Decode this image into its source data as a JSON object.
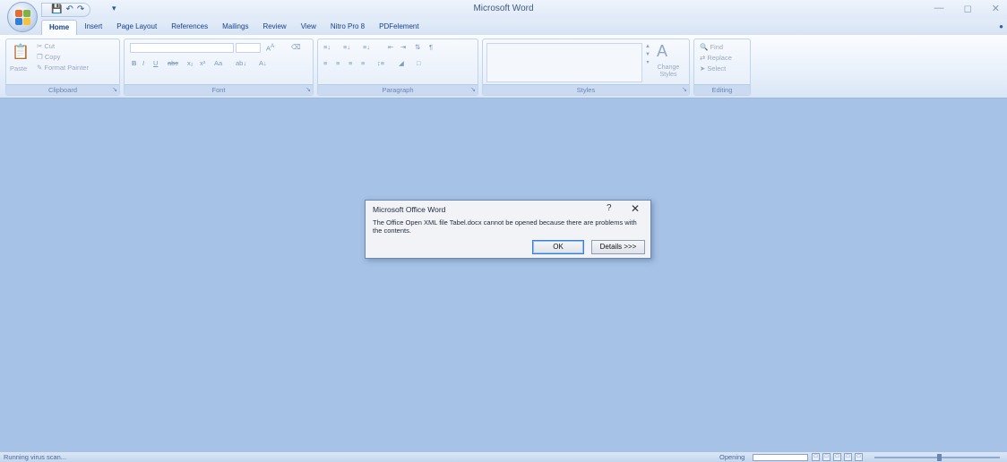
{
  "window": {
    "title": "Microsoft Word",
    "controls": [
      "—",
      "◻",
      "✕"
    ]
  },
  "quick_access": {
    "save_icon": "save-icon",
    "undo_icon": "undo-icon",
    "redo_icon": "redo-icon"
  },
  "ribbon_tabs": [
    {
      "label": "Home",
      "active": true
    },
    {
      "label": "Insert",
      "active": false
    },
    {
      "label": "Page Layout",
      "active": false
    },
    {
      "label": "References",
      "active": false
    },
    {
      "label": "Mailings",
      "active": false
    },
    {
      "label": "Review",
      "active": false
    },
    {
      "label": "View",
      "active": false
    },
    {
      "label": "Nitro Pro 8",
      "active": false
    },
    {
      "label": "PDFelement",
      "active": false
    }
  ],
  "ribbon": {
    "clipboard": {
      "label": "Clipboard",
      "paste": "Paste",
      "cut": "Cut",
      "copy": "Copy",
      "format_painter": "Format Painter"
    },
    "font": {
      "label": "Font"
    },
    "paragraph": {
      "label": "Paragraph"
    },
    "styles": {
      "label": "Styles",
      "change_styles": "Change Styles"
    },
    "editing": {
      "label": "Editing",
      "find": "Find",
      "replace": "Replace",
      "select": "Select"
    }
  },
  "dialog": {
    "title": "Microsoft Office Word",
    "help": "?",
    "close": "✕",
    "message": "The Office Open XML file Tabel.docx cannot be opened because there are problems with the contents.",
    "ok_label": "OK",
    "details_label": "Details >>>"
  },
  "status": {
    "left_text": "Running virus scan...",
    "opening_text": "Opening",
    "progress": 0.0
  },
  "colors": {
    "workspace": "#a6c2e6",
    "ribbon_text": "#15428b"
  }
}
